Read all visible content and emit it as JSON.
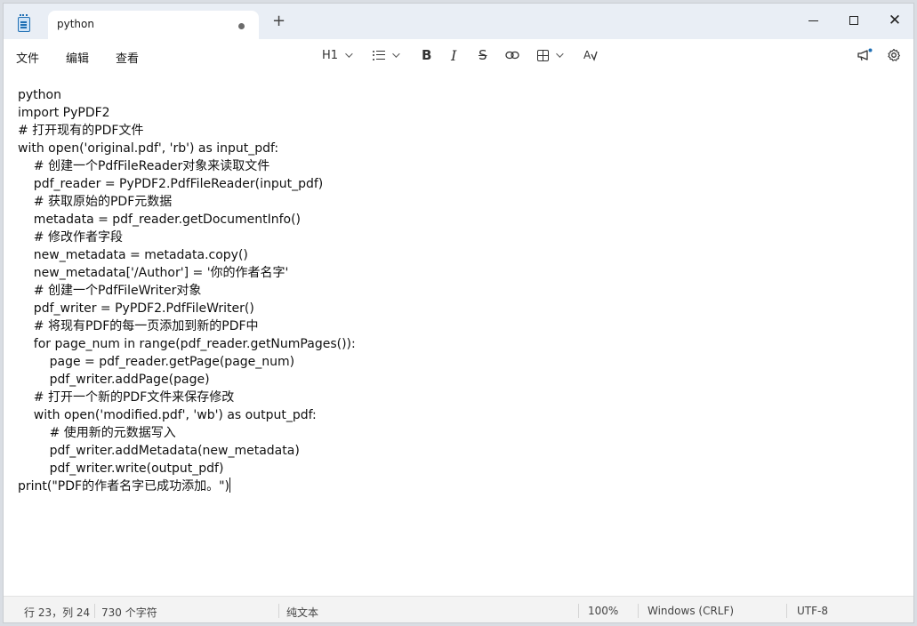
{
  "tab": {
    "title": "python"
  },
  "menu": {
    "file": "文件",
    "edit": "编辑",
    "view": "查看"
  },
  "toolbar": {
    "heading": "H1",
    "bold": "B",
    "italic": "I",
    "strikethrough": "S",
    "link": "🔗",
    "spellcheck": "A"
  },
  "editor": {
    "lines": [
      "python",
      "import PyPDF2",
      "# 打开现有的PDF文件",
      "with open('original.pdf', 'rb') as input_pdf:",
      "    # 创建一个PdfFileReader对象来读取文件",
      "    pdf_reader = PyPDF2.PdfFileReader(input_pdf)",
      "    # 获取原始的PDF元数据",
      "    metadata = pdf_reader.getDocumentInfo()",
      "    # 修改作者字段",
      "    new_metadata = metadata.copy()",
      "    new_metadata['/Author'] = '你的作者名字'",
      "    # 创建一个PdfFileWriter对象",
      "    pdf_writer = PyPDF2.PdfFileWriter()",
      "    # 将现有PDF的每一页添加到新的PDF中",
      "    for page_num in range(pdf_reader.getNumPages()):",
      "        page = pdf_reader.getPage(page_num)",
      "        pdf_writer.addPage(page)",
      "    # 打开一个新的PDF文件来保存修改",
      "    with open('modified.pdf', 'wb') as output_pdf:",
      "        # 使用新的元数据写入",
      "        pdf_writer.addMetadata(new_metadata)",
      "        pdf_writer.write(output_pdf)",
      "print(\"PDF的作者名字已成功添加。\")"
    ]
  },
  "status": {
    "position": "行 23，列 24",
    "char_count": "730 个字符",
    "format": "纯文本",
    "zoom": "100%",
    "line_ending": "Windows (CRLF)",
    "encoding": "UTF-8"
  },
  "colors": {
    "titlebar": "#e9eef5",
    "accent": "#1f6fb4",
    "notify_dot": "#1f6fb4"
  }
}
